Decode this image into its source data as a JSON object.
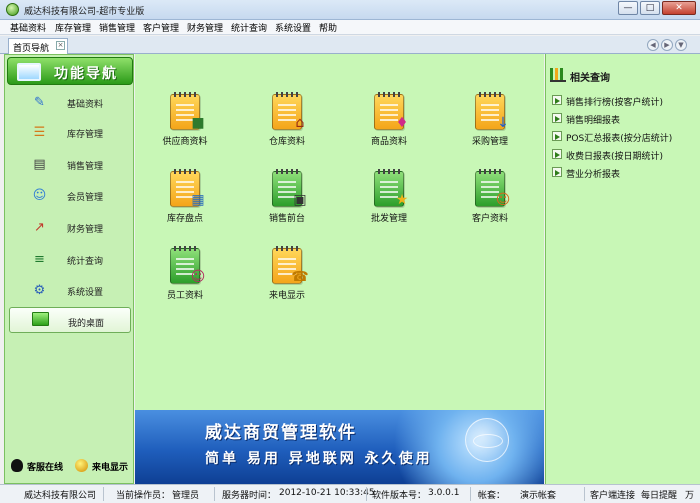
{
  "window": {
    "title": "威达科技有限公司-超市专业版",
    "minimize": "—",
    "maximize": "□",
    "close": "✕"
  },
  "menu": [
    "基础资料",
    "库存管理",
    "销售管理",
    "客户管理",
    "财务管理",
    "统计查询",
    "系统设置",
    "帮助"
  ],
  "tabs": {
    "active": "首页导航",
    "close": "×"
  },
  "nav_arrows": [
    "◀",
    "▶",
    "▼"
  ],
  "sidebar": {
    "title": "功能导航",
    "items": [
      {
        "label": "基础资料",
        "icon": "pencil-icon",
        "glyph": "✎",
        "color": "#2c6fd0"
      },
      {
        "label": "库存管理",
        "icon": "cart-icon",
        "glyph": "☰",
        "color": "#d4781a"
      },
      {
        "label": "销售管理",
        "icon": "cash-register-icon",
        "glyph": "▤",
        "color": "#444444"
      },
      {
        "label": "会员管理",
        "icon": "members-icon",
        "glyph": "☺",
        "color": "#2e7bd6"
      },
      {
        "label": "财务管理",
        "icon": "chart-icon",
        "glyph": "↗",
        "color": "#c0392b"
      },
      {
        "label": "统计查询",
        "icon": "stats-icon",
        "glyph": "≡",
        "color": "#1f7a2f"
      },
      {
        "label": "系统设置",
        "icon": "gear-icon",
        "glyph": "⚙",
        "color": "#2a5fb8"
      },
      {
        "label": "我的桌面",
        "icon": "monitor-icon",
        "glyph": "",
        "color": "#2ea11a",
        "active": true
      }
    ],
    "bottom": {
      "online_service": "客服在线",
      "caller_id": "来电显示"
    }
  },
  "tiles": [
    {
      "label": "供应商资料",
      "icon": "supplier-truck-icon",
      "glyph": "■",
      "style": "orange",
      "glyph_color": "#2d7a2d"
    },
    {
      "label": "仓库资料",
      "icon": "warehouse-house-icon",
      "glyph": "⌂",
      "style": "orange",
      "glyph_color": "#9a2a10"
    },
    {
      "label": "商品资料",
      "icon": "products-icon",
      "glyph": "♦",
      "style": "orange",
      "glyph_color": "#d02a8a"
    },
    {
      "label": "采购管理",
      "icon": "purchase-cart-icon",
      "glyph": "↓",
      "style": "orange",
      "glyph_color": "#1e5fd0"
    },
    {
      "label": "库存盘点",
      "icon": "inventory-calculator-icon",
      "glyph": "▦",
      "style": "orange",
      "glyph_color": "#2f6fb8"
    },
    {
      "label": "销售前台",
      "icon": "pos-register-icon",
      "glyph": "▣",
      "style": "green",
      "glyph_color": "#333333"
    },
    {
      "label": "批发管理",
      "icon": "wholesale-sale-icon",
      "glyph": "★",
      "style": "green",
      "glyph_color": "#f0b21a"
    },
    {
      "label": "客户资料",
      "icon": "customers-icon",
      "glyph": "☺",
      "style": "green",
      "glyph_color": "#d2691e"
    },
    {
      "label": "员工资料",
      "icon": "staff-icon",
      "glyph": "☺",
      "style": "green",
      "glyph_color": "#b03060"
    },
    {
      "label": "来电显示",
      "icon": "phone-icon",
      "glyph": "☎",
      "style": "orange",
      "glyph_color": "#c07a00"
    }
  ],
  "banner": {
    "title": "威达商贸管理软件",
    "slogan": "简单 易用 异地联网 永久使用"
  },
  "related": {
    "title": "相关查询",
    "items": [
      "销售排行榜(按客户统计)",
      "销售明细报表",
      "POS汇总报表(按分店统计)",
      "收费日报表(按日期统计)",
      "营业分析报表"
    ]
  },
  "status": {
    "company": "威达科技有限公司",
    "operator_label": "当前操作员：",
    "operator": "管理员",
    "server_time_label": "服务器时间：",
    "server_time": "2012-10-21 10:33:45",
    "version_label": "软件版本号：",
    "version": "3.0.0.1",
    "account_label": "帐套：",
    "account": "演示帐套",
    "client_connect": "客户端连接",
    "daily_reminder": "每日提醒",
    "extra": "万"
  }
}
